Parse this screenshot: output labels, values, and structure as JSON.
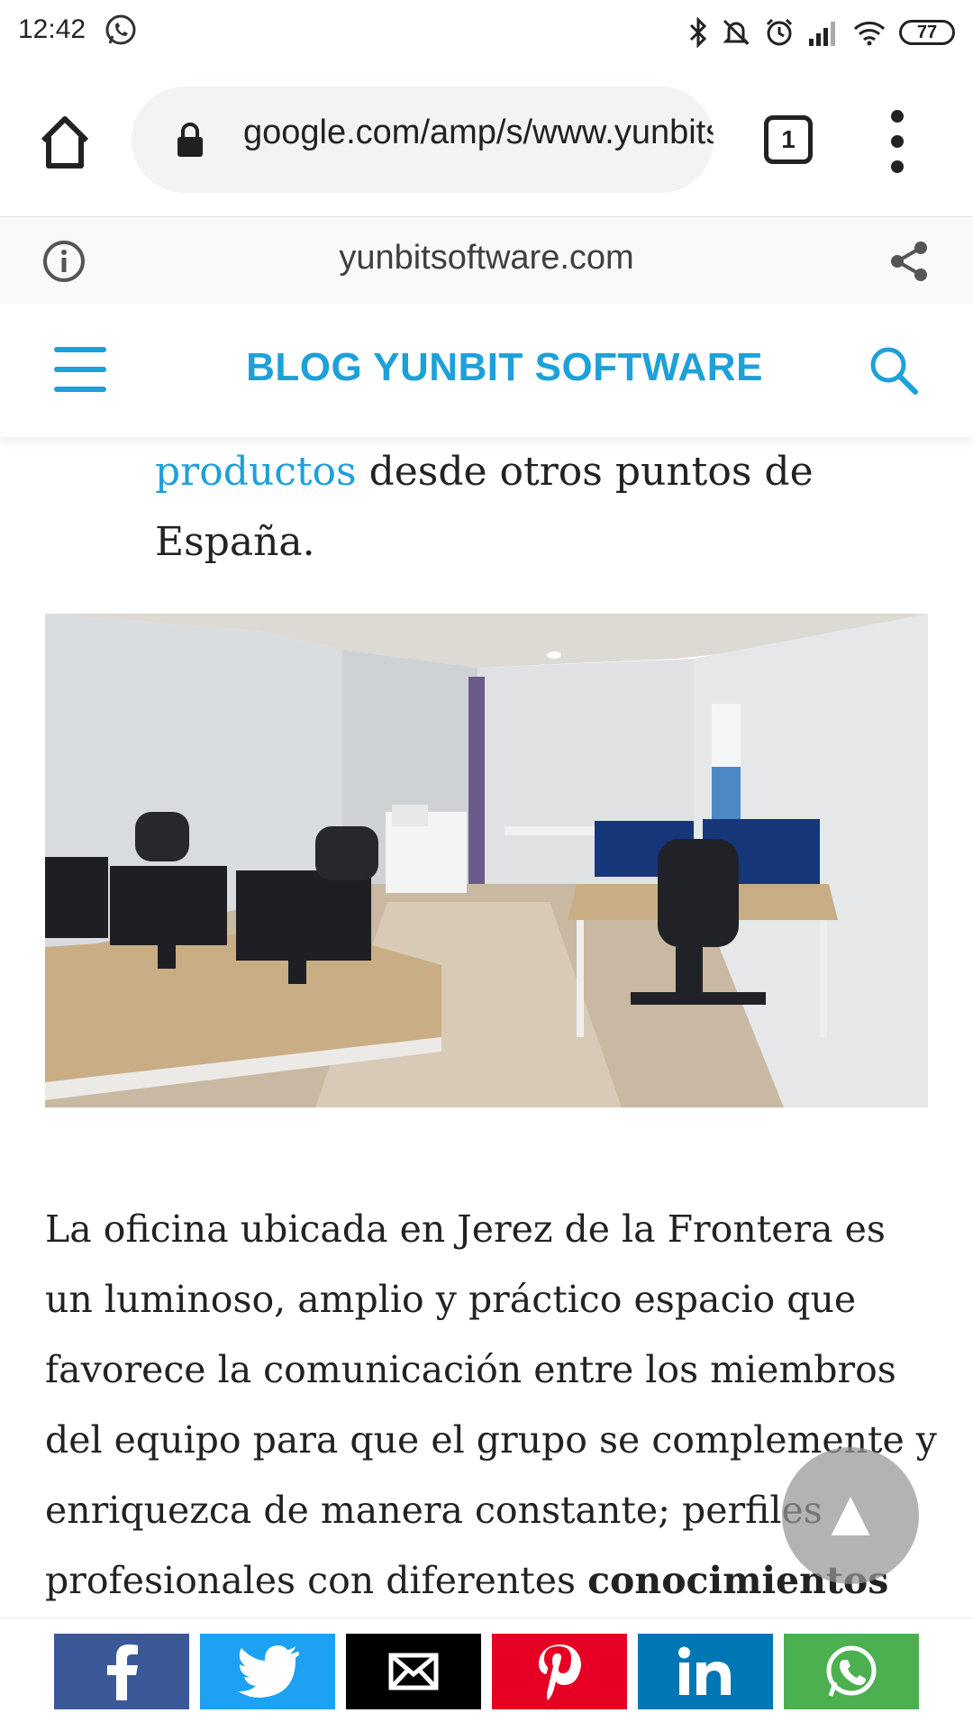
{
  "status_bar": {
    "time": "12:42",
    "battery": "77",
    "icons": [
      "whatsapp-icon",
      "bluetooth-icon",
      "mute-icon",
      "alarm-icon",
      "signal-icon",
      "wifi-icon",
      "battery-icon"
    ]
  },
  "browser": {
    "url": "google.com/amp/s/www.yunbitsoftware.com",
    "tab_count": "1"
  },
  "amp_bar": {
    "domain": "yunbitsoftware.com"
  },
  "site": {
    "title": "BLOG YUNBIT SOFTWARE",
    "accent_color": "#1ea0d9"
  },
  "article": {
    "top_link": "productos",
    "top_text_1": " desde otros puntos de",
    "top_text_2": "España.",
    "body": "La oficina ubicada en Jerez de la Frontera es un luminoso, amplio y práctico espacio que favorece la comunicación entre los miembros del equipo para que el grupo se complemente y enriquezca de manera constante; perfiles profesionales con diferentes ",
    "body_bold": "conocimientos"
  },
  "share_buttons": [
    {
      "name": "facebook",
      "color": "#3b5998"
    },
    {
      "name": "twitter",
      "color": "#1da1f2"
    },
    {
      "name": "email",
      "color": "#000000"
    },
    {
      "name": "pinterest",
      "color": "#e60023"
    },
    {
      "name": "linkedin",
      "color": "#0077b5"
    },
    {
      "name": "whatsapp",
      "color": "#4caf50"
    }
  ]
}
